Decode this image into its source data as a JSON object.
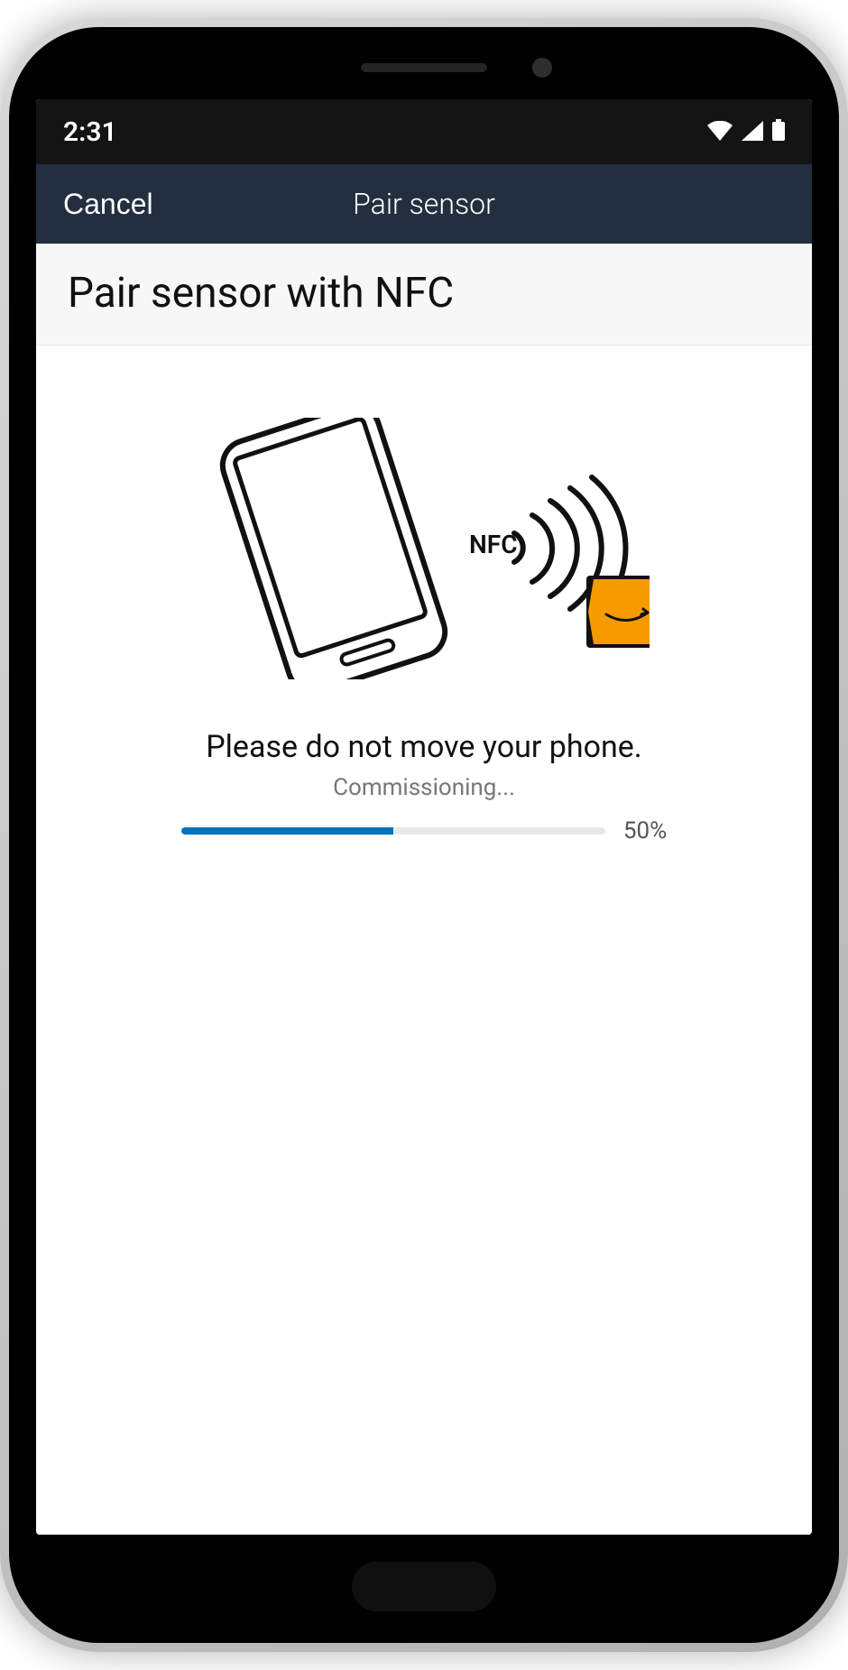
{
  "status_bar": {
    "time": "2:31"
  },
  "header": {
    "cancel_label": "Cancel",
    "title": "Pair sensor"
  },
  "page": {
    "title": "Pair sensor with NFC"
  },
  "illustration": {
    "nfc_label": "NFC"
  },
  "instruction": {
    "text": "Please do not move your phone.",
    "status": "Commissioning...",
    "progress_percent": 50,
    "progress_label": "50%"
  }
}
